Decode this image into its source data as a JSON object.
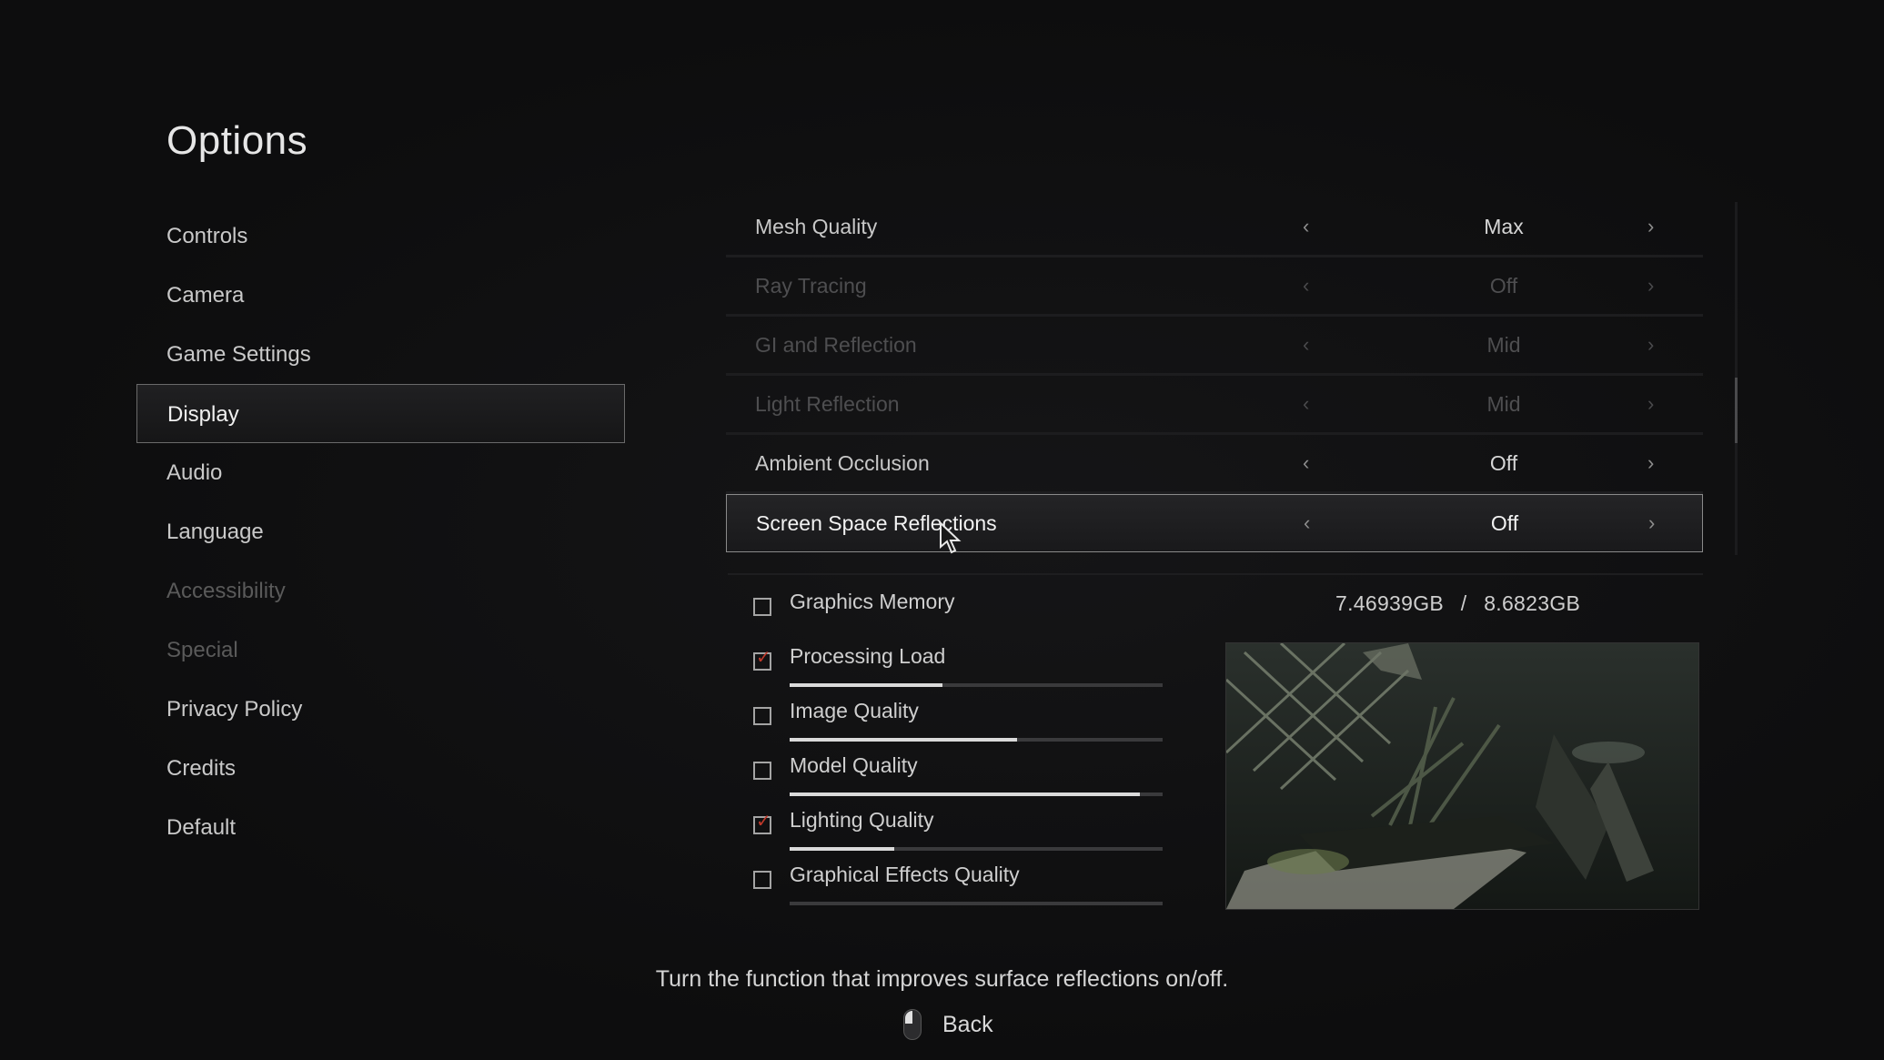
{
  "page_title": "Options",
  "menu": [
    {
      "label": "Controls",
      "state": "normal"
    },
    {
      "label": "Camera",
      "state": "normal"
    },
    {
      "label": "Game Settings",
      "state": "normal"
    },
    {
      "label": "Display",
      "state": "selected"
    },
    {
      "label": "Audio",
      "state": "normal"
    },
    {
      "label": "Language",
      "state": "normal"
    },
    {
      "label": "Accessibility",
      "state": "disabled"
    },
    {
      "label": "Special",
      "state": "disabled"
    },
    {
      "label": "Privacy Policy",
      "state": "normal"
    },
    {
      "label": "Credits",
      "state": "normal"
    },
    {
      "label": "Default",
      "state": "normal"
    }
  ],
  "settings": [
    {
      "label": "Mesh Quality",
      "value": "Max",
      "state": "normal"
    },
    {
      "label": "Ray Tracing",
      "value": "Off",
      "state": "disabled"
    },
    {
      "label": "GI and Reflection",
      "value": "Mid",
      "state": "disabled"
    },
    {
      "label": "Light Reflection",
      "value": "Mid",
      "state": "disabled"
    },
    {
      "label": "Ambient Occlusion",
      "value": "Off",
      "state": "normal"
    },
    {
      "label": "Screen Space Reflections",
      "value": "Off",
      "state": "active"
    }
  ],
  "graphics_memory": {
    "label": "Graphics Memory",
    "checked": false,
    "used": "7.46939GB",
    "separator": "/",
    "total": "8.6823GB"
  },
  "performance_bars": [
    {
      "label": "Processing Load",
      "checked": true,
      "level": 0.41
    },
    {
      "label": "Image Quality",
      "checked": false,
      "level": 0.61
    },
    {
      "label": "Model Quality",
      "checked": false,
      "level": 0.94
    },
    {
      "label": "Lighting Quality",
      "checked": true,
      "level": 0.28
    },
    {
      "label": "Graphical Effects Quality",
      "checked": false,
      "level": 0.0
    }
  ],
  "hint_text": "Turn the function that improves surface reflections on/off.",
  "back_label": "Back",
  "icons": {
    "arrow_left": "‹",
    "arrow_right": "›",
    "check": "✓"
  },
  "colors": {
    "background": "#0d0d0e",
    "check_mark": "#c0392b",
    "text": "#c8c8c8"
  }
}
